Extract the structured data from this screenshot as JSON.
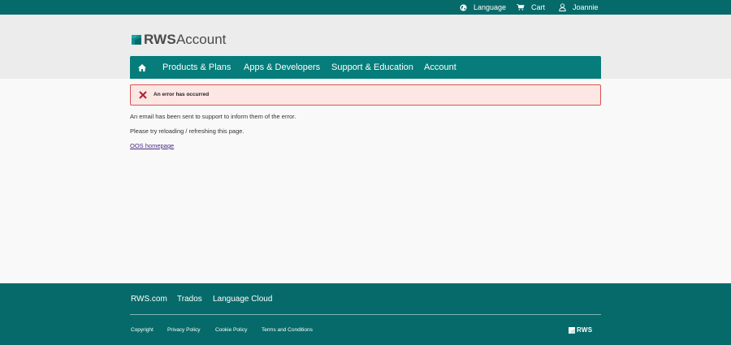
{
  "topbar": {
    "language": {
      "label": "Language",
      "icon": "globe-icon"
    },
    "cart": {
      "label": "Cart",
      "icon": "cart-icon"
    },
    "user": {
      "label": "Joannie",
      "icon": "user-icon"
    }
  },
  "logo": {
    "brand": "RWS",
    "product": "Account"
  },
  "nav": {
    "home_icon": "home-icon",
    "items": [
      "Products & Plans",
      "Apps & Developers",
      "Support & Education",
      "Account"
    ]
  },
  "alert": {
    "message": "An error has occurred",
    "icon": "close-icon"
  },
  "content": {
    "line1": "An email has been sent to support to inform them of the error.",
    "line2": "Please try reloading / refreshing this page.",
    "link": "OOS homepage"
  },
  "footer": {
    "links": [
      "RWS.com",
      "Trados",
      "Language Cloud"
    ],
    "legal": [
      "Copyright",
      "Privacy Policy",
      "Cookie Policy",
      "Terms and Conditions"
    ],
    "logo": "RWS"
  },
  "colors": {
    "teal_dark": "#066a6a",
    "teal_nav": "#067d7a",
    "alert_bg": "#fce7e4",
    "alert_border": "#d9534f",
    "error_x": "#b0212b"
  }
}
